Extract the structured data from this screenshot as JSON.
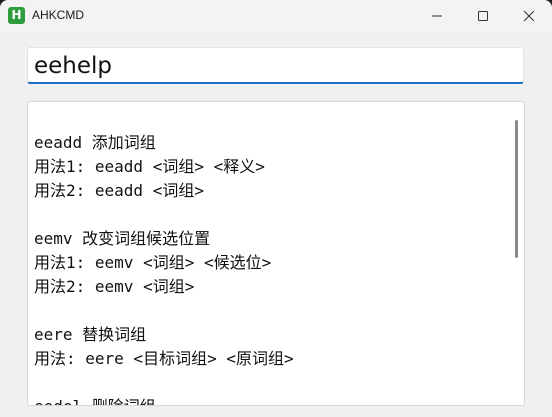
{
  "window": {
    "title": "AHKCMD",
    "icon_letter": "H",
    "icon_color": "#2e9c3c"
  },
  "controls": {
    "minimize": "minimize-icon",
    "maximize": "maximize-icon",
    "close": "close-icon"
  },
  "command_input": {
    "value": "eehelp"
  },
  "output": {
    "lines": [
      "eeadd 添加词组",
      "用法1: eeadd <词组> <释义>",
      "用法2: eeadd <词组>",
      "",
      "eemv 改变词组候选位置",
      "用法1: eemv <词组> <候选位>",
      "用法2: eemv <词组>",
      "",
      "eere 替换词组",
      "用法: eere <目标词组> <原词组>",
      "",
      "eedel 删除词组"
    ]
  },
  "colors": {
    "accent": "#1a6fc0",
    "window_bg": "#f0f0f0"
  }
}
